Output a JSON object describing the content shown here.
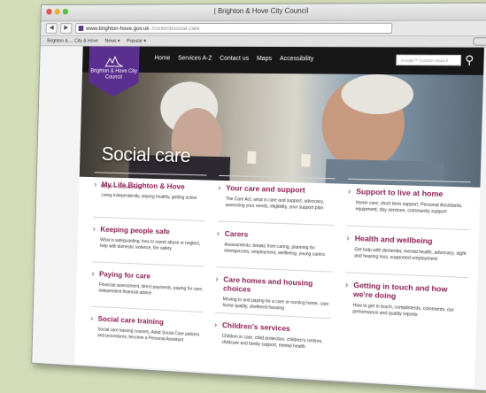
{
  "window": {
    "title": "| Brighton & Hove City Council"
  },
  "browser": {
    "url_host": "www.brighton-hove.gov.uk",
    "url_path": "/content/social-care",
    "bookmarks": [
      "Brighton & ... City & Hove",
      "News ▾",
      "Popular ▾"
    ]
  },
  "site": {
    "logo_text": "Brighton & Hove City Council",
    "nav": [
      "Home",
      "Services A-Z",
      "Contact us",
      "Maps",
      "Accessibility"
    ],
    "search_placeholder": "Google™ Custom Search"
  },
  "hero": {
    "title": "Social care"
  },
  "breadcrumb": "Home » Social care",
  "cards": [
    {
      "title": "My Life Brighton & Hove",
      "desc": "Living independently, staying healthy, getting active"
    },
    {
      "title": "Your care and support",
      "desc": "The Care Act, what is care and support, advocacy, assessing your needs, eligibility, your support plan"
    },
    {
      "title": "Support to live at home",
      "desc": "Home care, short term support, Personal Assistants, equipment, day services, community support"
    },
    {
      "title": "Keeping people safe",
      "desc": "What is safeguarding, how to report abuse or neglect, help with domestic violence, fire safety"
    },
    {
      "title": "Carers",
      "desc": "Assessments, breaks from caring, planning for emergencies, employment, wellbeing, young carers"
    },
    {
      "title": "Health and wellbeing",
      "desc": "Get help with dementia, mental health, advocacy, sight and hearing loss, supported employment"
    },
    {
      "title": "Paying for care",
      "desc": "Financial assessment, direct payments, paying for care, independent financial advice"
    },
    {
      "title": "Care homes and housing choices",
      "desc": "Moving to and paying for a care or nursing home, care home quality, sheltered housing"
    },
    {
      "title": "Getting in touch and how we're doing",
      "desc": "How to get in touch, compliments, comments, our performance and quality reports"
    },
    {
      "title": "Social care training",
      "desc": "Social care training courses, Adult Social Care policies and procedures, become a Personal Assistant"
    },
    {
      "title": "Children's services",
      "desc": "Children in care, child protection, children's centres, childcare and family support, mental health"
    },
    {
      "title": "",
      "desc": ""
    }
  ]
}
